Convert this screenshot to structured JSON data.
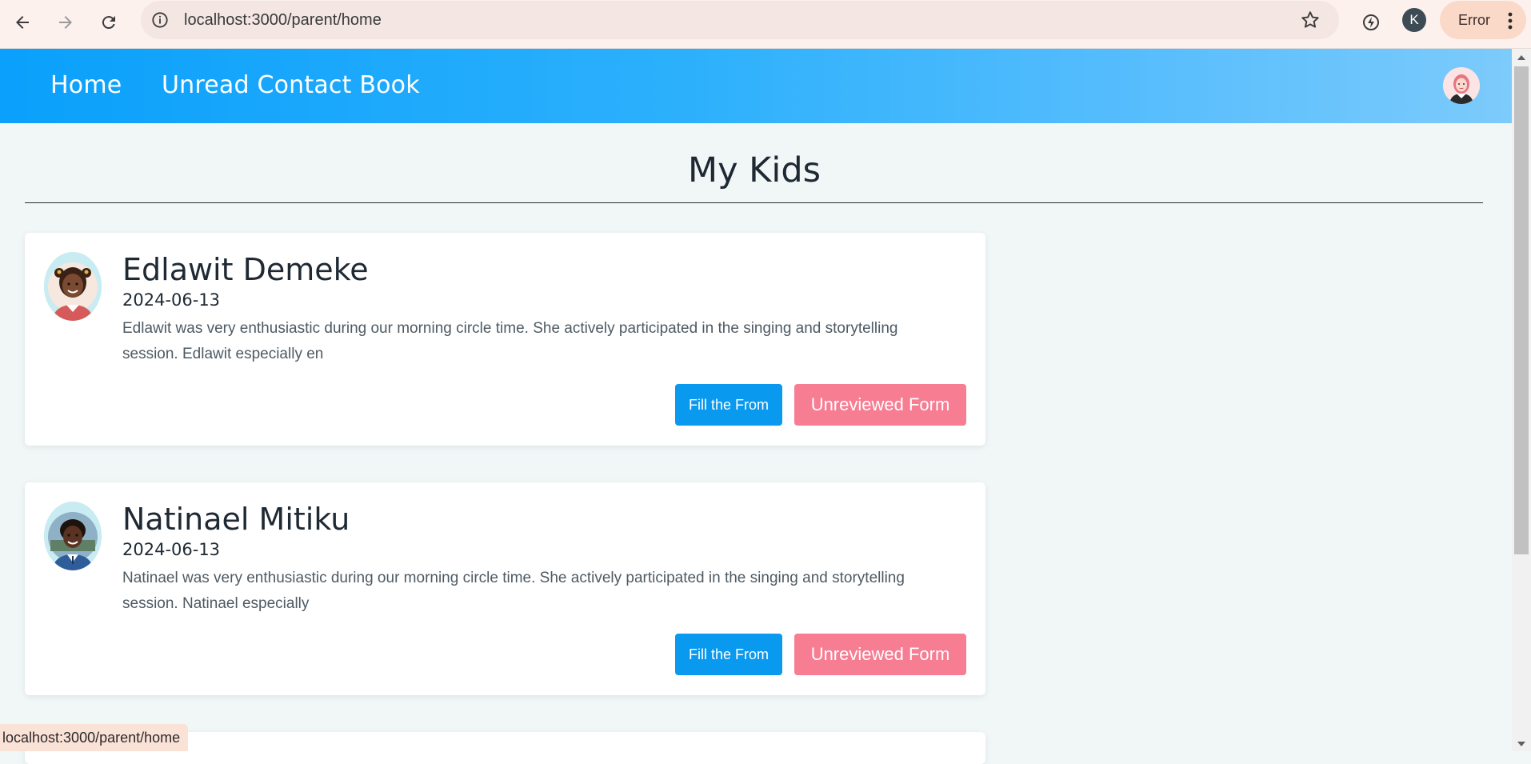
{
  "browser": {
    "url": "localhost:3000/parent/home",
    "profile_initial": "K",
    "error_label": "Error",
    "status_url": "localhost:3000/parent/home"
  },
  "navbar": {
    "links": [
      {
        "label": "Home"
      },
      {
        "label": "Unread Contact Book"
      }
    ]
  },
  "page": {
    "title": "My Kids"
  },
  "kids": [
    {
      "name": "Edlawit Demeke",
      "date": "2024-06-13",
      "note": "Edlawit was very enthusiastic during our morning circle time. She actively participated in the singing and storytelling session. Edlawit especially en",
      "fill_button": "Fill the From",
      "unreviewed_button": "Unreviewed Form"
    },
    {
      "name": "Natinael Mitiku",
      "date": "2024-06-13",
      "note": "Natinael was very enthusiastic during our morning circle time. She actively participated in the singing and storytelling session. Natinael especially",
      "fill_button": "Fill the From",
      "unreviewed_button": "Unreviewed Form"
    }
  ],
  "colors": {
    "navbar_start": "#0aa0fb",
    "navbar_end": "#7ccbfb",
    "fill_button": "#0999ee",
    "unreviewed_button": "#f77d93",
    "page_bg": "#f1f6f7"
  },
  "icons": [
    "back-arrow-icon",
    "forward-arrow-icon",
    "reload-icon",
    "info-icon",
    "star-icon",
    "performance-icon",
    "more-vert-icon",
    "user-avatar-icon"
  ]
}
